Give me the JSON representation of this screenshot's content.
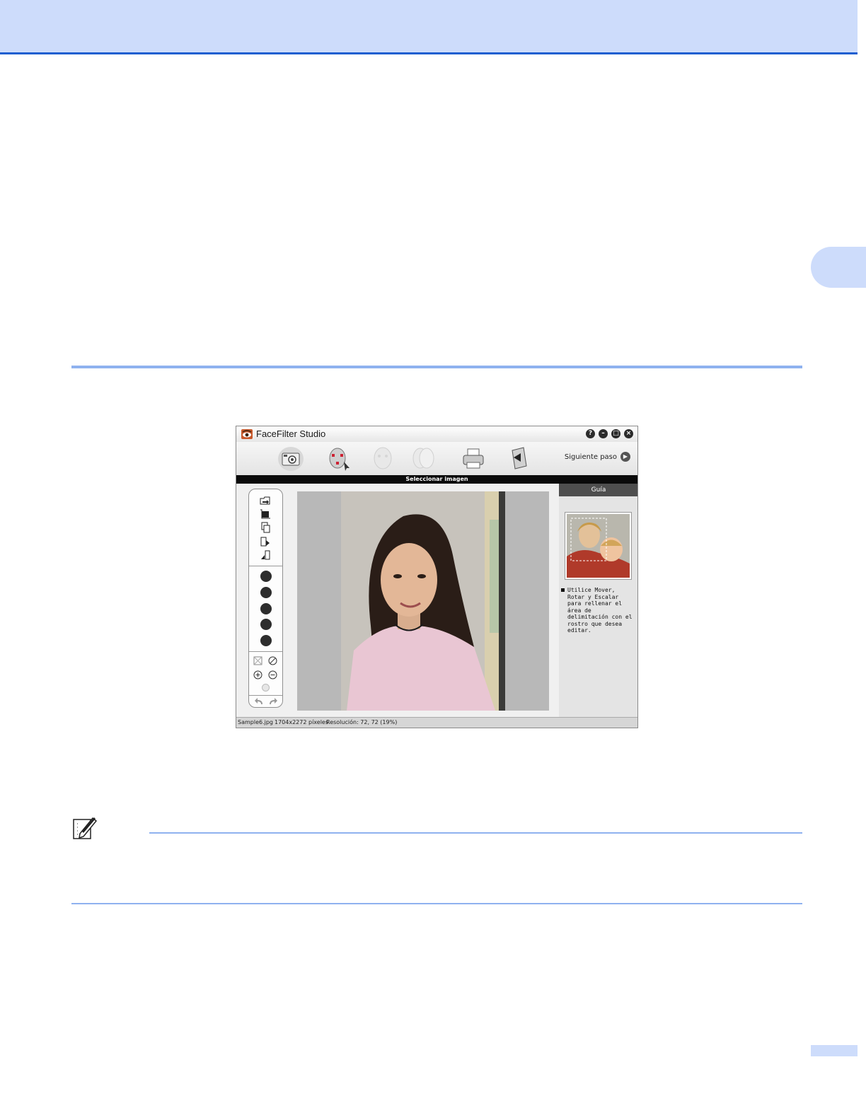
{
  "app": {
    "title": "FaceFilter Studio",
    "next_step_label": "Siguiente paso",
    "caption": "Seleccionar imagen",
    "window_buttons": [
      "?",
      "–",
      "□",
      "×"
    ],
    "steps": [
      {
        "icon": "camera-icon",
        "active": true
      },
      {
        "icon": "face-select-icon",
        "active": false
      },
      {
        "icon": "face-edit-icon",
        "active": false
      },
      {
        "icon": "face-compare-icon",
        "active": false
      },
      {
        "icon": "printer-icon",
        "active": false
      },
      {
        "icon": "exit-icon",
        "active": false
      }
    ],
    "tools": [
      "open-file-icon",
      "crop-icon",
      "copy-icon",
      "rotate-icon",
      "flip-icon",
      "brush-icon",
      "pipette-icon",
      "face-tool-icon",
      "frame-tool-icon",
      "zoom-face-icon",
      "fit-icon",
      "reset-icon",
      "zoom-in-icon",
      "zoom-out-icon",
      "hand-icon",
      "undo-icon",
      "redo-icon"
    ],
    "guide": {
      "header": "Guía",
      "text": "Utilice Mover, Rotar y Escalar para rellenar el área de delimitación con el rostro que desea editar."
    },
    "status": {
      "filename": "Sample6.jpg",
      "dimensions": "1704x2272 píxeles",
      "resolution": "Resolución: 72, 72 (19%)"
    }
  },
  "colors": {
    "header_band": "#cddcfb",
    "header_rule": "#1d5fd0",
    "section_rule": "#8fb2ef"
  }
}
